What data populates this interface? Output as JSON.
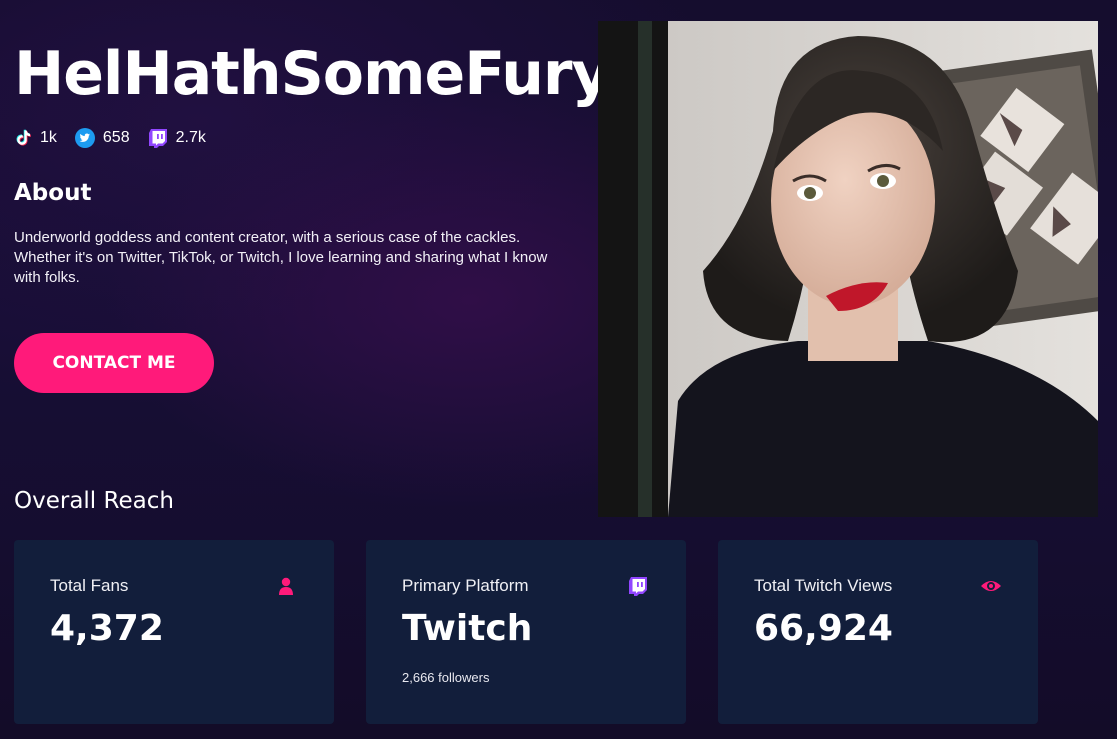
{
  "profile": {
    "name": "HelHathSomeFury",
    "socials": [
      {
        "icon": "tiktok-icon",
        "count": "1k"
      },
      {
        "icon": "twitter-icon",
        "count": "658"
      },
      {
        "icon": "twitch-icon",
        "count": "2.7k"
      }
    ]
  },
  "about": {
    "heading": "About",
    "text": "Underworld goddess and content creator, with a serious case of the cackles. Whether it's on Twitter, TikTok, or Twitch, I love learning and sharing what I know with folks."
  },
  "contact": {
    "label": "CONTACT ME"
  },
  "reach": {
    "heading": "Overall Reach",
    "cards": [
      {
        "label": "Total Fans",
        "value": "4,372",
        "icon": "user-icon"
      },
      {
        "label": "Primary Platform",
        "value": "Twitch",
        "sub": "2,666 followers",
        "icon": "twitch-icon"
      },
      {
        "label": "Total Twitch Views",
        "value": "66,924",
        "icon": "eye-icon"
      }
    ]
  },
  "colors": {
    "accent": "#ff1a7a",
    "card": "#121e3b",
    "twitch": "#9146ff",
    "twitter": "#1d9bf0"
  }
}
